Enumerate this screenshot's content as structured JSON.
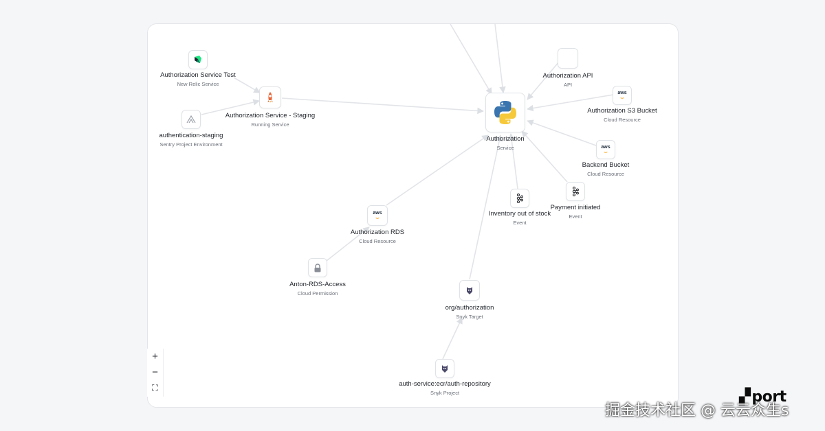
{
  "nodes": [
    {
      "id": "auth-service-test",
      "title": "Authorization Service Test",
      "subtitle": "New Relic Service",
      "icon": "new-relic-icon"
    },
    {
      "id": "auth-service-staging",
      "title": "Authorization Service - Staging",
      "subtitle": "Running Service",
      "icon": "rocket-icon"
    },
    {
      "id": "authentication-staging",
      "title": "authentication-staging",
      "subtitle": "Sentry Project Environment",
      "icon": "sentry-icon"
    },
    {
      "id": "authorization",
      "title": "Authorization",
      "subtitle": "Service",
      "icon": "python-icon"
    },
    {
      "id": "authorization-api",
      "title": "Authorization API",
      "subtitle": "API",
      "icon": "api-icon"
    },
    {
      "id": "authorization-s3",
      "title": "Authorization S3 Bucket",
      "subtitle": "Cloud Resource",
      "icon": "aws-icon"
    },
    {
      "id": "backend-bucket",
      "title": "Backend Bucket",
      "subtitle": "Cloud Resource",
      "icon": "aws-icon"
    },
    {
      "id": "payment-initiated",
      "title": "Payment initiated",
      "subtitle": "Event",
      "icon": "kafka-icon"
    },
    {
      "id": "inventory-out",
      "title": "Inventory out of stock",
      "subtitle": "Event",
      "icon": "kafka-icon"
    },
    {
      "id": "authorization-rds",
      "title": "Authorization RDS",
      "subtitle": "Cloud Resource",
      "icon": "aws-icon"
    },
    {
      "id": "anton-rds-access",
      "title": "Anton-RDS-Access",
      "subtitle": "Cloud Permission",
      "icon": "lock-icon"
    },
    {
      "id": "org-authorization",
      "title": "org/authorization",
      "subtitle": "Snyk Target",
      "icon": "snyk-icon"
    },
    {
      "id": "auth-repository",
      "title": "auth-service:ecr/auth-repository",
      "subtitle": "Snyk Project",
      "icon": "snyk-icon"
    }
  ],
  "aws_text": "aws",
  "zoom_controls": {
    "zoom_in": "+",
    "zoom_out": "−",
    "fit": "⛶"
  },
  "brand": {
    "name": "port"
  },
  "watermark": "掘金技术社区 @ 云云众生s",
  "colors": {
    "edge": "#dcdfe3",
    "node_border": "#dfe2e6",
    "python_blue": "#3b75b0",
    "python_yellow": "#f6c93b",
    "rocket": "#e8673a",
    "aws": "#232f3e",
    "aws_orange": "#ff9900"
  }
}
